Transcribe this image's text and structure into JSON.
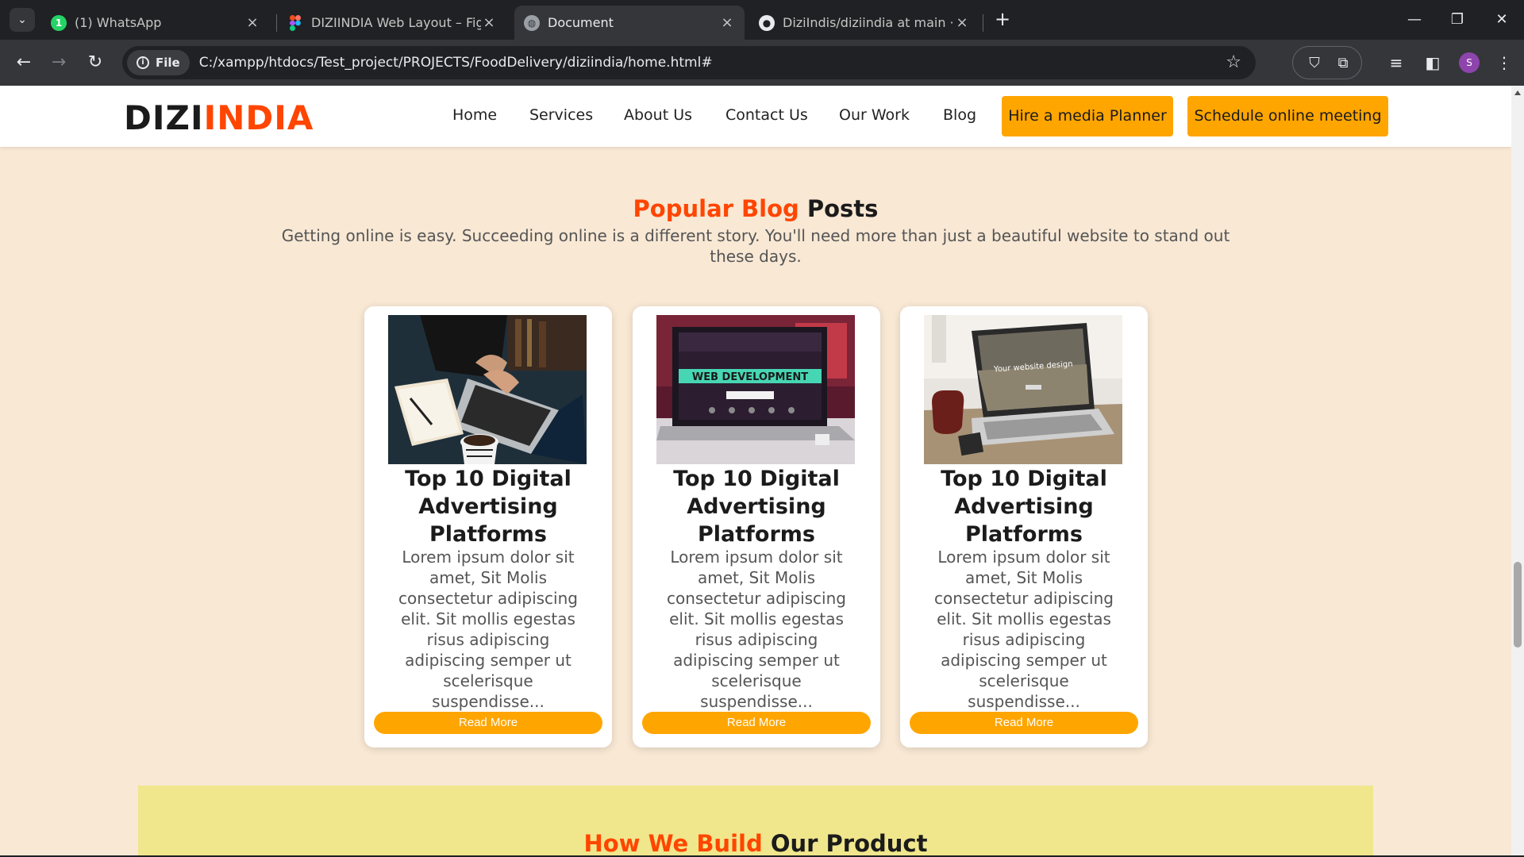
{
  "browser": {
    "tabs": [
      {
        "title": "(1) WhatsApp",
        "icon": "whatsapp-icon",
        "badge": "1",
        "active": false
      },
      {
        "title": "DIZIINDIA Web Layout – Figma",
        "icon": "figma-icon",
        "active": false
      },
      {
        "title": "Document",
        "icon": "globe-icon",
        "active": true
      },
      {
        "title": "DiziIndis/diziindia at main · sha",
        "icon": "github-icon",
        "active": false
      }
    ],
    "chip_label": "File",
    "url": "C:/xampp/htdocs/Test_project/PROJECTS/FoodDelivery/diziindia/home.html#",
    "profile_initial": "S"
  },
  "site": {
    "logo_dark": "DIZI",
    "logo_accent": "INDIA",
    "nav": [
      "Home",
      "Services",
      "About Us",
      "Contact Us",
      "Our Work",
      "Blog"
    ],
    "cta_primary": "Hire a media Planner",
    "cta_secondary": "Schedule online meeting"
  },
  "blog": {
    "title_highlight": "Popular Blog",
    "title_rest": "Posts",
    "subtitle": "Getting online is easy. Succeeding online is a different story. You'll need more than just a beautiful website to stand out these days.",
    "cards": [
      {
        "title": "Top 10 Digital Advertising Platforms",
        "text": "Lorem ipsum dolor sit amet, Sit Molis consectetur adipiscing elit. Sit mollis egestas risus adipiscing adipiscing semper ut scelerisque suspendisse...",
        "button": "Read More",
        "image_text": ""
      },
      {
        "title": "Top 10 Digital Advertising Platforms",
        "text": "Lorem ipsum dolor sit amet, Sit Molis consectetur adipiscing elit. Sit mollis egestas risus adipiscing adipiscing semper ut scelerisque suspendisse...",
        "button": "Read More",
        "image_text": "WEB DEVELOPMENT"
      },
      {
        "title": "Top 10 Digital Advertising Platforms",
        "text": "Lorem ipsum dolor sit amet, Sit Molis consectetur adipiscing elit. Sit mollis egestas risus adipiscing adipiscing semper ut scelerisque suspendisse...",
        "button": "Read More",
        "image_text": "Your website design"
      }
    ]
  },
  "build": {
    "title_highlight": "How We Build",
    "title_rest": "Our Product"
  },
  "colors": {
    "accent": "#ff4500",
    "button": "#ffa500",
    "page_bg": "#f8e8d4",
    "section_bg": "#f0e68c"
  }
}
